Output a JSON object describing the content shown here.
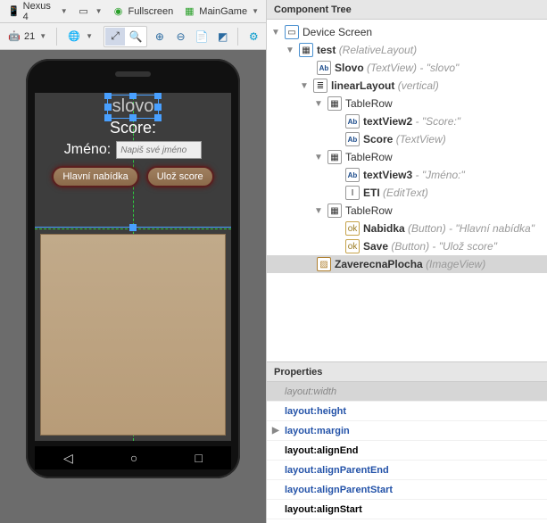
{
  "toolbar1": {
    "device": "Nexus 4",
    "fullscreen_label": "Fullscreen",
    "maingame_label": "MainGame"
  },
  "toolbar2": {
    "api_label": "21"
  },
  "preview": {
    "slovo_text": "slovo",
    "score_label": "Score:",
    "jmeno_label": "Jméno:",
    "jmeno_placeholder": "Napiš své jméno",
    "btn_nabidka": "Hlavní nabídka",
    "btn_save": "Ulož score"
  },
  "tree": {
    "header": "Component Tree",
    "device_screen": "Device Screen",
    "test_name": "test",
    "test_type": "(RelativeLayout)",
    "slovo_name": "Slovo",
    "slovo_type": "(TextView)",
    "slovo_val": "slovo",
    "ll_name": "linearLayout",
    "ll_type": "(vertical)",
    "tablerow": "TableRow",
    "tv2_name": "textView2",
    "tv2_val": "Score:",
    "score_name": "Score",
    "score_type": "(TextView)",
    "tv3_name": "textView3",
    "tv3_val": "Jméno:",
    "eti_name": "ETI",
    "eti_type": "(EditText)",
    "nab_name": "Nabidka",
    "nab_type": "(Button)",
    "nab_val": "Hlavní nabídka",
    "save_name": "Save",
    "save_type": "(Button)",
    "save_val": "Ulož score",
    "zav_name": "ZaverecnaPlocha",
    "zav_type": "(ImageView)"
  },
  "props": {
    "header": "Properties",
    "p1": "layout:width",
    "p2": "layout:height",
    "p3": "layout:margin",
    "p4": "layout:alignEnd",
    "p5": "layout:alignParentEnd",
    "p6": "layout:alignParentStart",
    "p7": "layout:alignStart"
  }
}
